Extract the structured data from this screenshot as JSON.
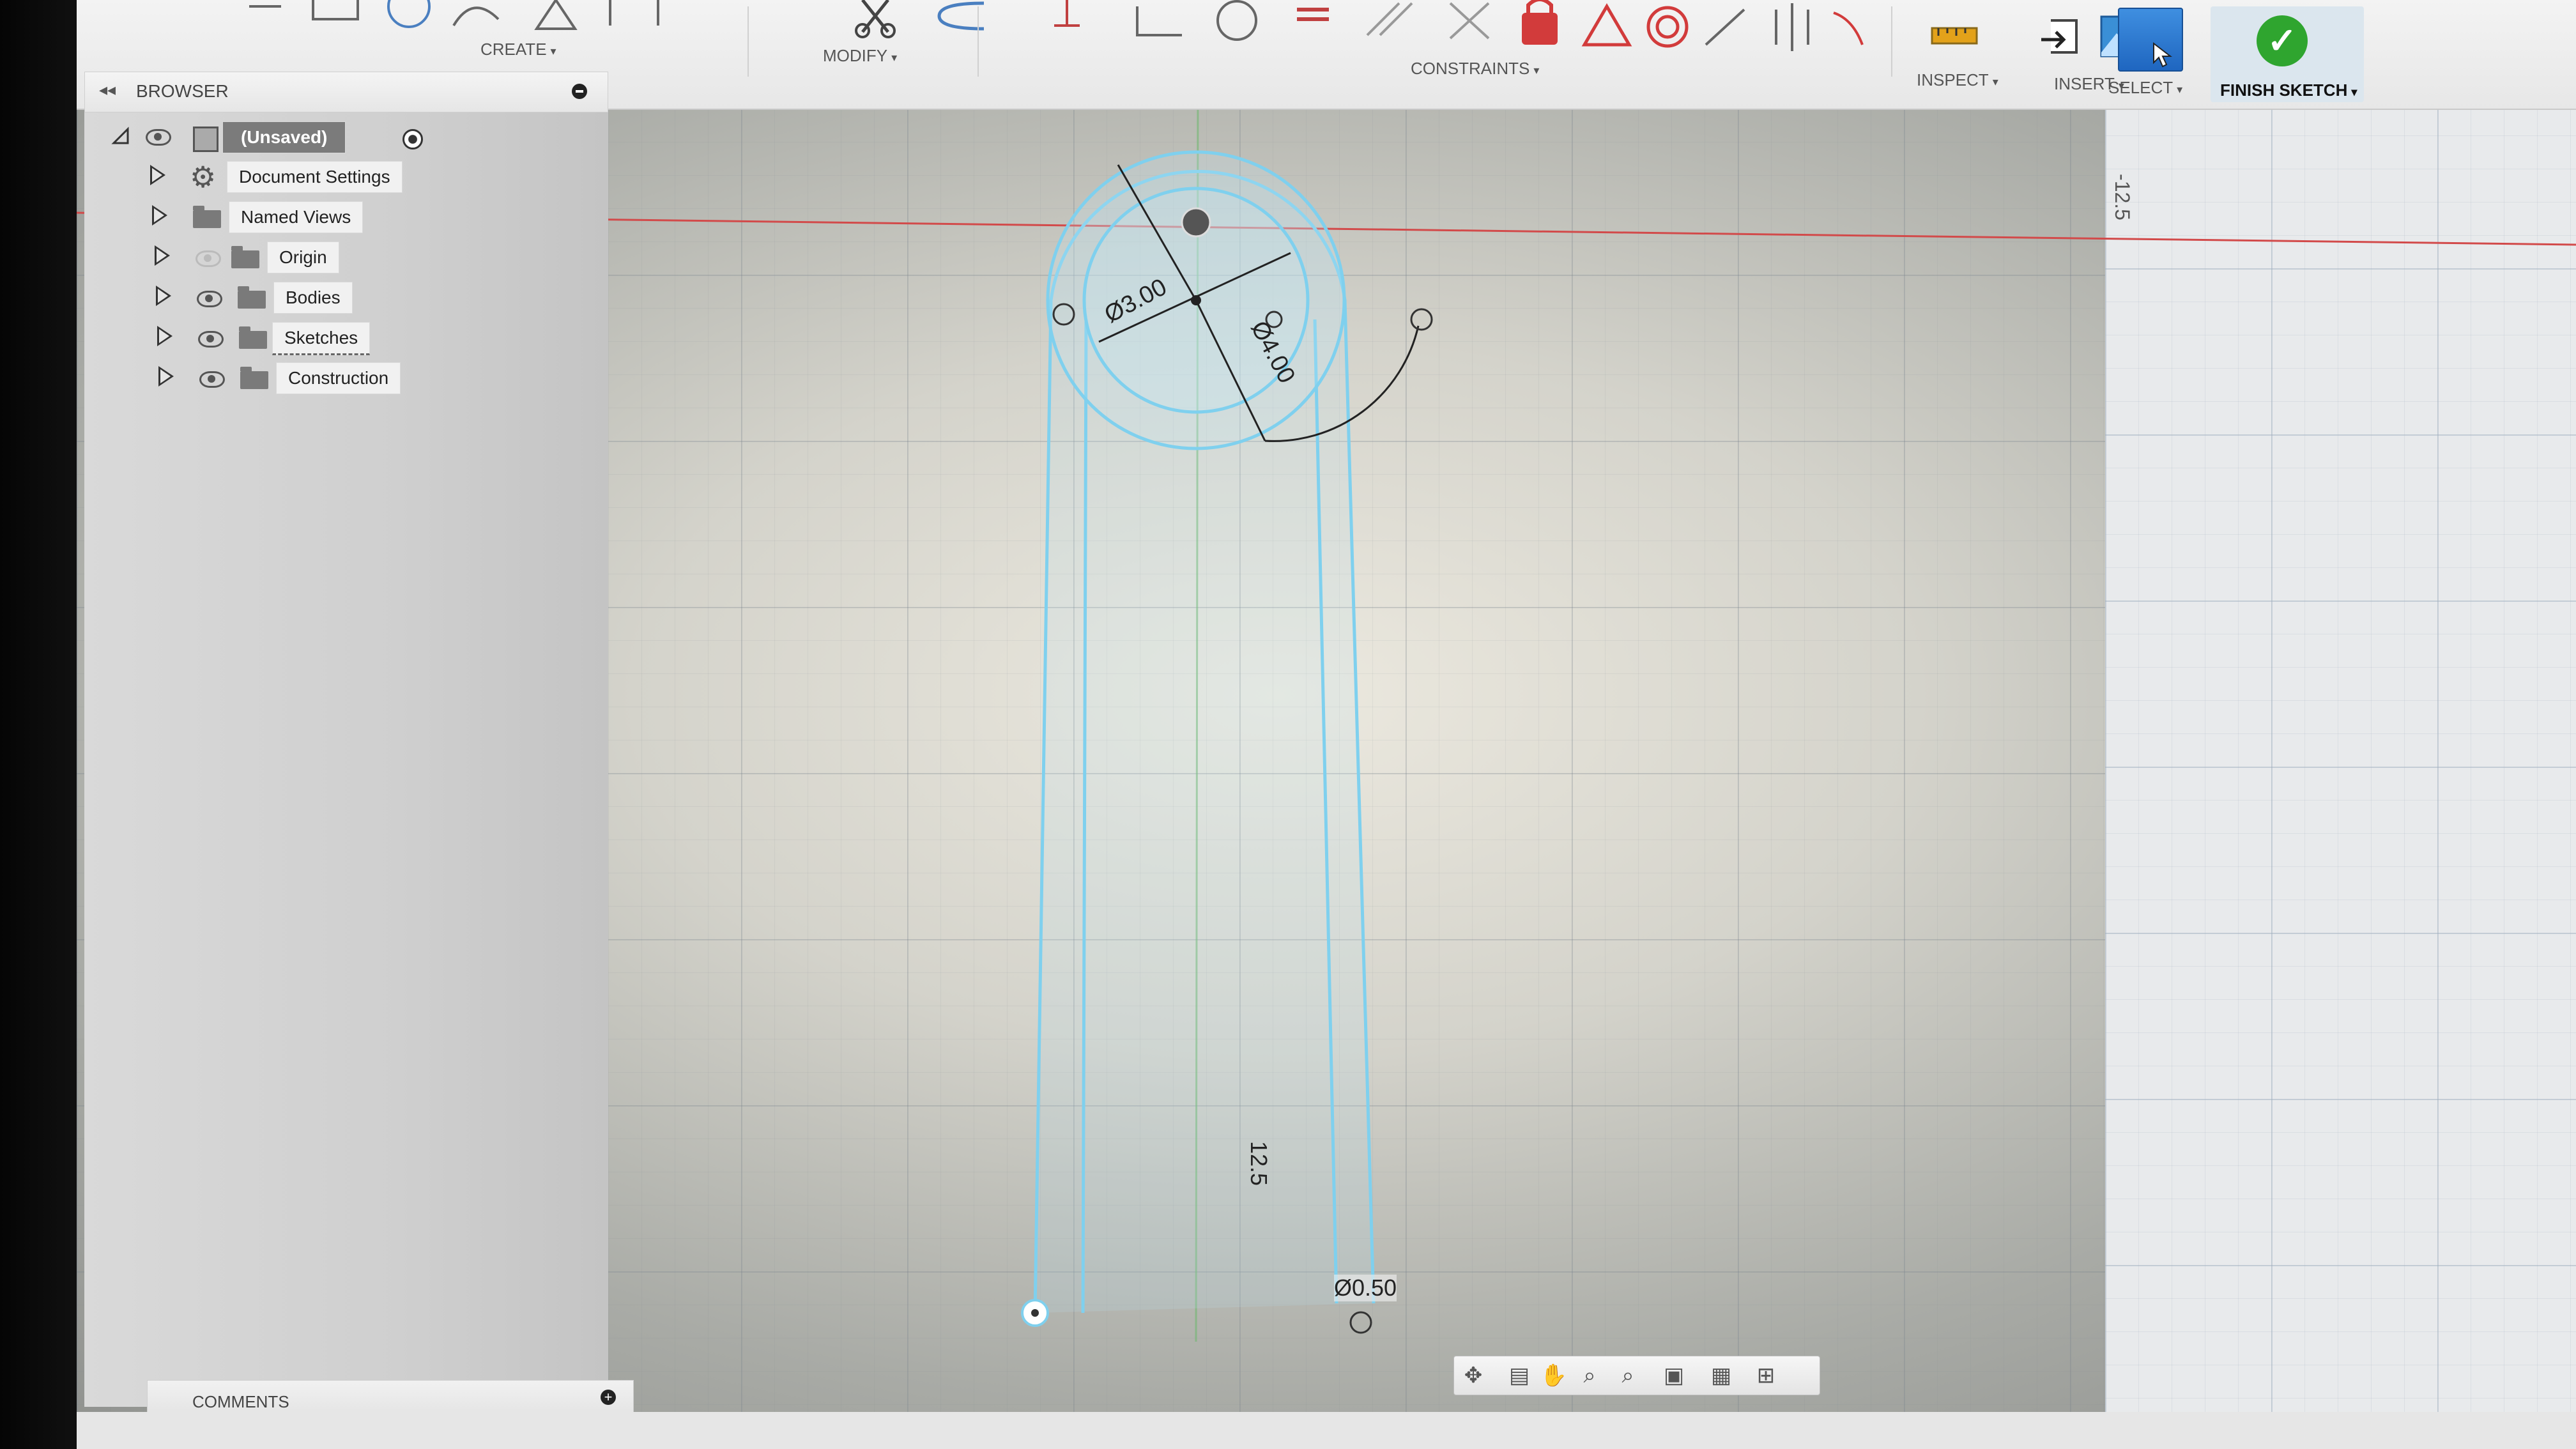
{
  "toolbar": {
    "create_label": "CREATE",
    "modify_label": "MODIFY",
    "constraints_label": "CONSTRAINTS",
    "inspect_label": "INSPECT",
    "insert_label": "INSERT",
    "select_label": "SELECT",
    "finish_sketch_label": "FINISH SKETCH",
    "caret": "▾"
  },
  "browser": {
    "title": "BROWSER",
    "collapse_glyph": "◂◂",
    "items": [
      {
        "label": "(Unsaved)"
      },
      {
        "label": "Document Settings"
      },
      {
        "label": "Named Views"
      },
      {
        "label": "Origin"
      },
      {
        "label": "Bodies"
      },
      {
        "label": "Sketches"
      },
      {
        "label": "Construction"
      }
    ]
  },
  "comments": {
    "label": "COMMENTS",
    "add_glyph": "+"
  },
  "sketch": {
    "dim_inner_diameter": "Ø3.00",
    "dim_outer_diameter": "Ø4.00",
    "dim_length": "12.5",
    "dim_ruler": "-12.5",
    "dim_small_diameter": "Ø0.50"
  },
  "colors": {
    "sketch_line": "#7fd0ee",
    "axis_red": "#d24a4a",
    "axis_green": "#6fb86f",
    "select_blue": "#2b78d0",
    "finish_green": "#2fa52f"
  }
}
